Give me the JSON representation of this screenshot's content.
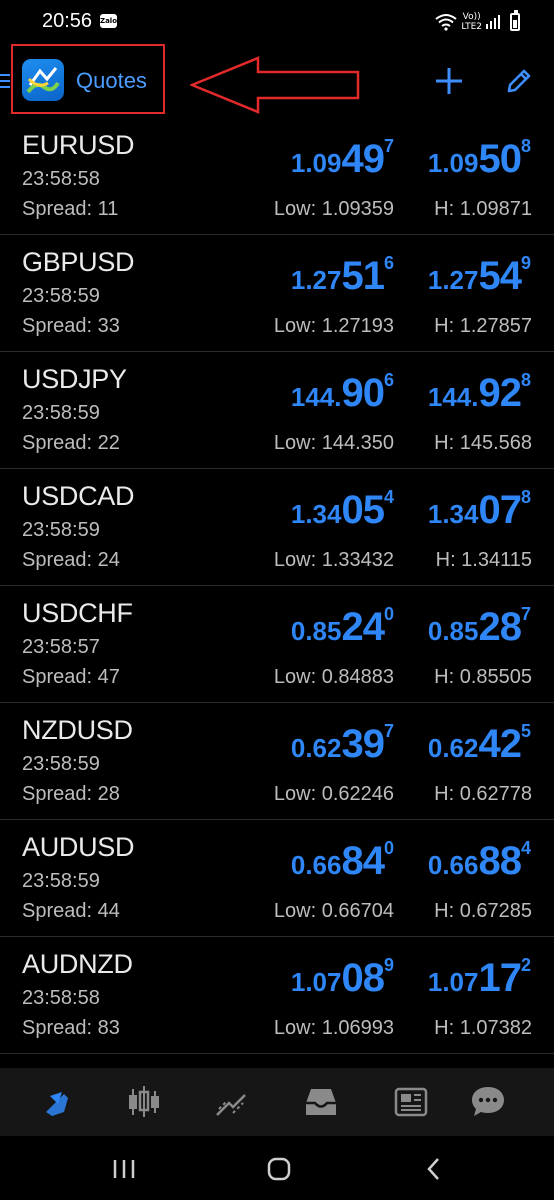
{
  "status_bar": {
    "time": "20:56",
    "notification_app": "Zalo",
    "network_top": "Vo))",
    "network_bottom": "LTE2"
  },
  "header": {
    "title": "Quotes",
    "icons": {
      "menu": "hamburger-menu-icon",
      "logo": "metatrader-logo",
      "add": "plus-icon",
      "edit": "pencil-icon"
    }
  },
  "quotes": [
    {
      "symbol": "EURUSD",
      "time": "23:58:58",
      "spread": "Spread: 11",
      "bid": {
        "pre": "1.09",
        "big": "49",
        "sup": "7"
      },
      "ask": {
        "pre": "1.09",
        "big": "50",
        "sup": "8"
      },
      "low": "Low: 1.09359",
      "high": "H: 1.09871"
    },
    {
      "symbol": "GBPUSD",
      "time": "23:58:59",
      "spread": "Spread: 33",
      "bid": {
        "pre": "1.27",
        "big": "51",
        "sup": "6"
      },
      "ask": {
        "pre": "1.27",
        "big": "54",
        "sup": "9"
      },
      "low": "Low: 1.27193",
      "high": "H: 1.27857"
    },
    {
      "symbol": "USDJPY",
      "time": "23:58:59",
      "spread": "Spread: 22",
      "bid": {
        "pre": "144.",
        "big": "90",
        "sup": "6"
      },
      "ask": {
        "pre": "144.",
        "big": "92",
        "sup": "8"
      },
      "low": "Low: 144.350",
      "high": "H: 145.568"
    },
    {
      "symbol": "USDCAD",
      "time": "23:58:59",
      "spread": "Spread: 24",
      "bid": {
        "pre": "1.34",
        "big": "05",
        "sup": "4"
      },
      "ask": {
        "pre": "1.34",
        "big": "07",
        "sup": "8"
      },
      "low": "Low: 1.33432",
      "high": "H: 1.34115"
    },
    {
      "symbol": "USDCHF",
      "time": "23:58:57",
      "spread": "Spread: 47",
      "bid": {
        "pre": "0.85",
        "big": "24",
        "sup": "0"
      },
      "ask": {
        "pre": "0.85",
        "big": "28",
        "sup": "7"
      },
      "low": "Low: 0.84883",
      "high": "H: 0.85505"
    },
    {
      "symbol": "NZDUSD",
      "time": "23:58:59",
      "spread": "Spread: 28",
      "bid": {
        "pre": "0.62",
        "big": "39",
        "sup": "7"
      },
      "ask": {
        "pre": "0.62",
        "big": "42",
        "sup": "5"
      },
      "low": "Low: 0.62246",
      "high": "H: 0.62778"
    },
    {
      "symbol": "AUDUSD",
      "time": "23:58:59",
      "spread": "Spread: 44",
      "bid": {
        "pre": "0.66",
        "big": "84",
        "sup": "0"
      },
      "ask": {
        "pre": "0.66",
        "big": "88",
        "sup": "4"
      },
      "low": "Low: 0.66704",
      "high": "H: 0.67285"
    },
    {
      "symbol": "AUDNZD",
      "time": "23:58:58",
      "spread": "Spread: 83",
      "bid": {
        "pre": "1.07",
        "big": "08",
        "sup": "9"
      },
      "ask": {
        "pre": "1.07",
        "big": "17",
        "sup": "2"
      },
      "low": "Low: 1.06993",
      "high": "H: 1.07382"
    }
  ],
  "bottom_nav": [
    {
      "icon": "quotes-arrows-icon",
      "active": true
    },
    {
      "icon": "candlestick-chart-icon",
      "active": false
    },
    {
      "icon": "trade-chart-icon",
      "active": false
    },
    {
      "icon": "inbox-icon",
      "active": false
    },
    {
      "icon": "news-icon",
      "active": false
    },
    {
      "icon": "chat-icon",
      "active": false
    }
  ],
  "colors": {
    "accent": "#2f86f7",
    "annotation": "#e22a2a",
    "nav_inactive": "#8a8a8a"
  }
}
